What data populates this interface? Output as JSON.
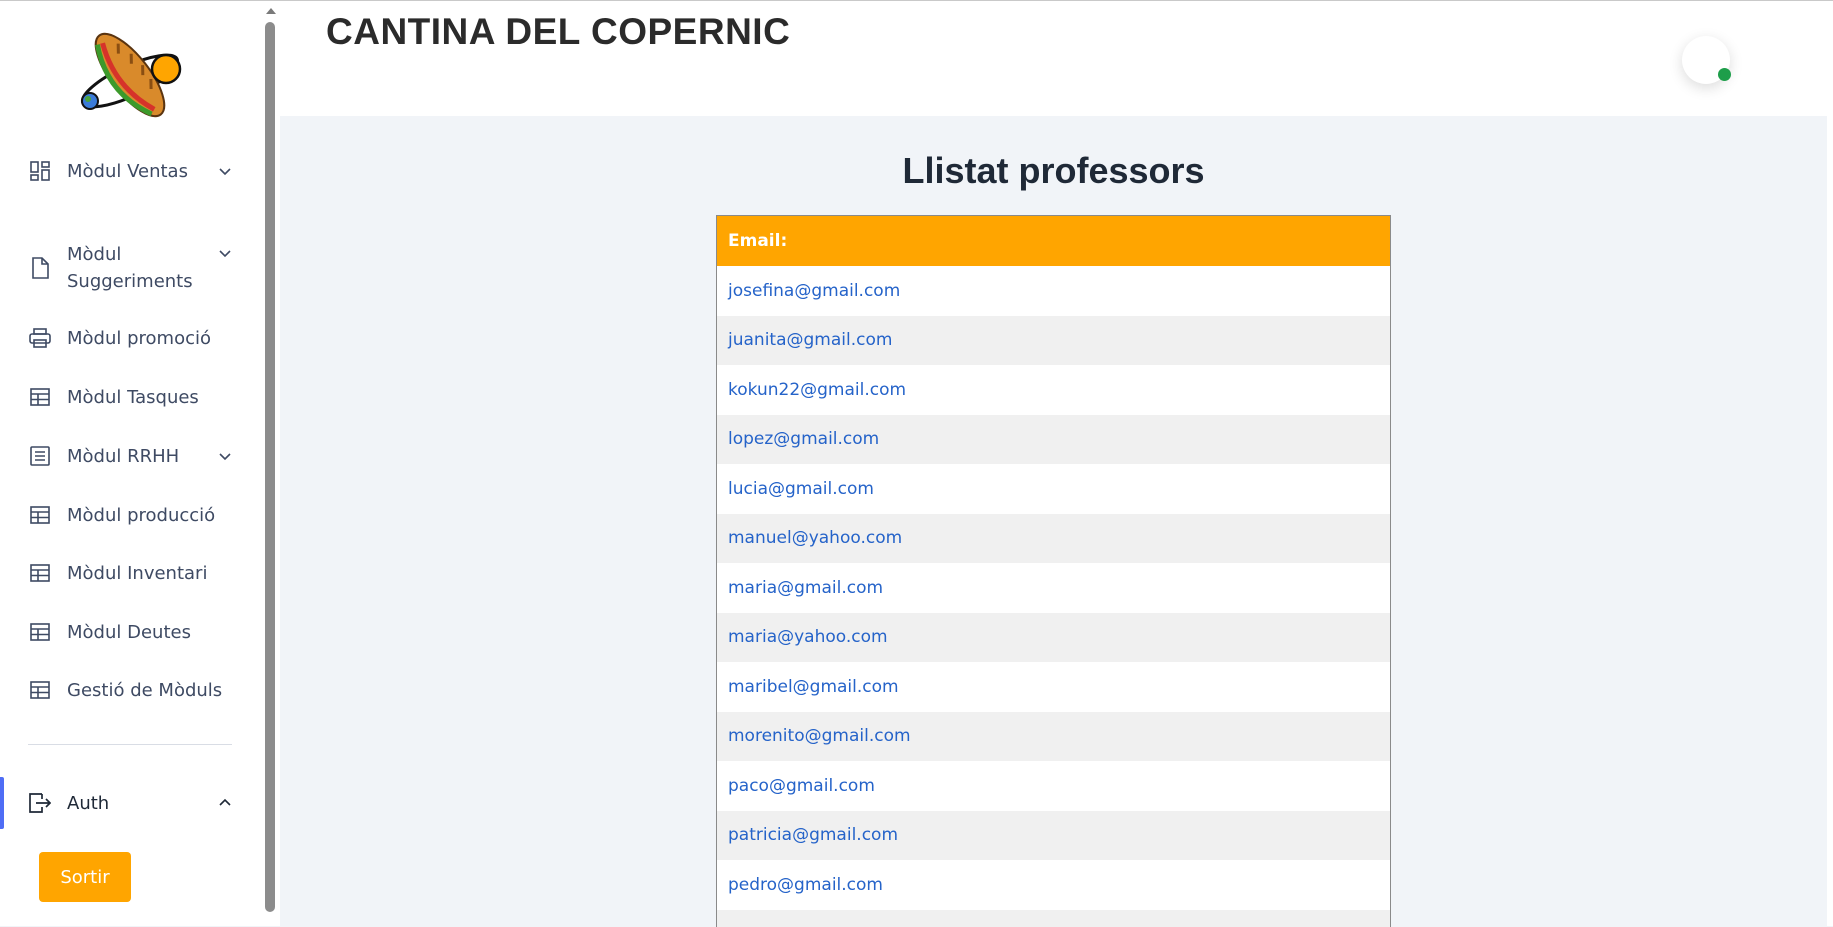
{
  "app": {
    "title": "CANTINA DEL COPERNIC"
  },
  "sidebar": {
    "items": [
      {
        "label": "Mòdul Ventas",
        "icon": "dashboard-grid-icon",
        "has_chevron": true
      },
      {
        "label": "Mòdul Suggeriments",
        "icon": "document-icon",
        "has_chevron": true
      },
      {
        "label": "Mòdul promoció",
        "icon": "printer-icon",
        "has_chevron": false
      },
      {
        "label": "Mòdul Tasques",
        "icon": "table-icon",
        "has_chevron": false
      },
      {
        "label": "Mòdul RRHH",
        "icon": "list-document-icon",
        "has_chevron": true
      },
      {
        "label": "Mòdul producció",
        "icon": "table-icon",
        "has_chevron": false
      },
      {
        "label": "Mòdul Inventari",
        "icon": "table-icon",
        "has_chevron": false
      },
      {
        "label": "Mòdul Deutes",
        "icon": "table-icon",
        "has_chevron": false
      },
      {
        "label": "Gestió de Mòduls",
        "icon": "table-icon",
        "has_chevron": false
      }
    ],
    "auth": {
      "label": "Auth",
      "icon": "logout-icon",
      "expanded": true
    },
    "logout_button": "Sortir"
  },
  "colors": {
    "accent": "#ffa500",
    "active": "#4f6df5",
    "link": "#2563c9",
    "online": "#1e9e4a"
  },
  "main": {
    "title": "Llistat professors",
    "table": {
      "header": "Email:",
      "rows": [
        "josefina@gmail.com",
        "juanita@gmail.com",
        "kokun22@gmail.com",
        "lopez@gmail.com",
        "lucia@gmail.com",
        "manuel@yahoo.com",
        "maria@gmail.com",
        "maria@yahoo.com",
        "maribel@gmail.com",
        "morenito@gmail.com",
        "paco@gmail.com",
        "patricia@gmail.com",
        "pedro@gmail.com"
      ]
    }
  }
}
